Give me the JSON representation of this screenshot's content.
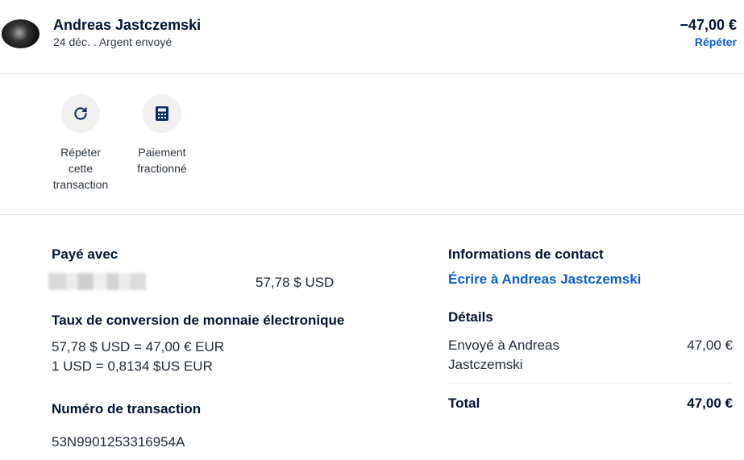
{
  "header": {
    "name": "Andreas Jastczemski",
    "subtitle": "24 déc. . Argent envoyé",
    "amount": "−47,00 €",
    "repeat_link": "Répéter"
  },
  "actions": [
    {
      "label": "Répéter\ncette\ntransaction",
      "icon": "refresh-icon"
    },
    {
      "label": "Paiement\nfractionné",
      "icon": "calculator-icon"
    }
  ],
  "paid_with": {
    "title": "Payé avec",
    "amount": "57,78 $ USD"
  },
  "conversion": {
    "title": "Taux de conversion de monnaie électronique",
    "line1": "57,78 $ USD = 47,00 € EUR",
    "line2": "1 USD = 0,8134 $US EUR"
  },
  "transaction": {
    "title": "Numéro de transaction",
    "id": "53N9901253316954A"
  },
  "contact": {
    "title": "Informations de contact",
    "link": "Écrire à Andreas Jastczemski"
  },
  "details": {
    "title": "Détails",
    "sent_to_line1": "Envoyé à Andreas",
    "sent_to_line2": "Jastczemski",
    "sent_amount": "47,00 €",
    "total_label": "Total",
    "total_amount": "47,00 €"
  },
  "colors": {
    "brand_dark": "#001435",
    "link_blue": "#0b5ed7",
    "icon_bg": "#f2f1ef"
  }
}
